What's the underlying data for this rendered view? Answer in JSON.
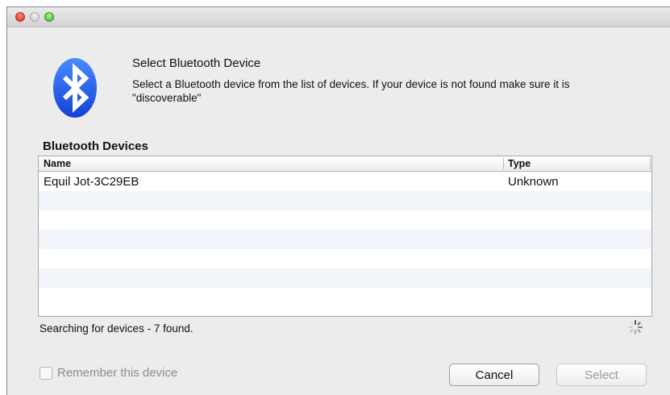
{
  "window": {
    "title": "",
    "controls": [
      "close",
      "minimize",
      "zoom"
    ]
  },
  "header": {
    "icon": "bluetooth-icon",
    "title": "Select Bluetooth Device",
    "description": "Select a Bluetooth device from the list of devices. If your device is not found make sure it is \"discoverable\""
  },
  "devices": {
    "section_title": "Bluetooth Devices",
    "columns": [
      "Name",
      "Type"
    ],
    "rows": [
      {
        "name": "Equil Jot-3C29EB",
        "type": "Unknown"
      }
    ]
  },
  "status": {
    "text": "Searching for devices - 7 found.",
    "spinner_icon": "progress-spinner-icon"
  },
  "footer": {
    "remember_label": "Remember this device",
    "remember_checked": false,
    "cancel_label": "Cancel",
    "select_label": "Select"
  },
  "colors": {
    "bluetooth_blue": "#1f5fe8",
    "alternate_row": "#f2f5fa",
    "window_bg": "#ececec"
  }
}
